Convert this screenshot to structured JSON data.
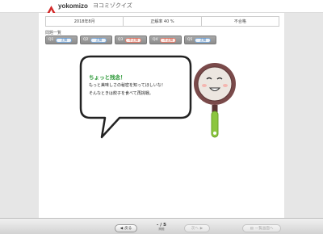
{
  "header": {
    "logo_text": "yokomizo",
    "app_title": "ヨコミゾクイズ"
  },
  "status": {
    "date": "2018年8月",
    "accuracy": "正解率 40 %",
    "result": "不合格"
  },
  "question_list": {
    "label": "問題一覧",
    "items": [
      {
        "num": "Q1",
        "badge": "正解"
      },
      {
        "num": "Q2",
        "badge": "正解"
      },
      {
        "num": "Q3",
        "badge": "不正解"
      },
      {
        "num": "Q4",
        "badge": "不正解"
      },
      {
        "num": "Q5",
        "badge": "正解"
      }
    ]
  },
  "message": {
    "title": "ちょっと残念！",
    "line1": "もっと美味しさの秘密を知ってほしいな！",
    "line2": "そんなときは餃子を食べて再挑戦。"
  },
  "colors": {
    "accent_green": "#2f9a3a",
    "logo_red": "#d32a2a",
    "pan_handle": "#8cc63f",
    "pan_body": "#7a4a4a"
  },
  "footer": {
    "back_label": "戻る",
    "page_indicator": "- / 5",
    "page_sub": "問題",
    "next_label": "次へ",
    "list_label": "一覧画面へ"
  }
}
